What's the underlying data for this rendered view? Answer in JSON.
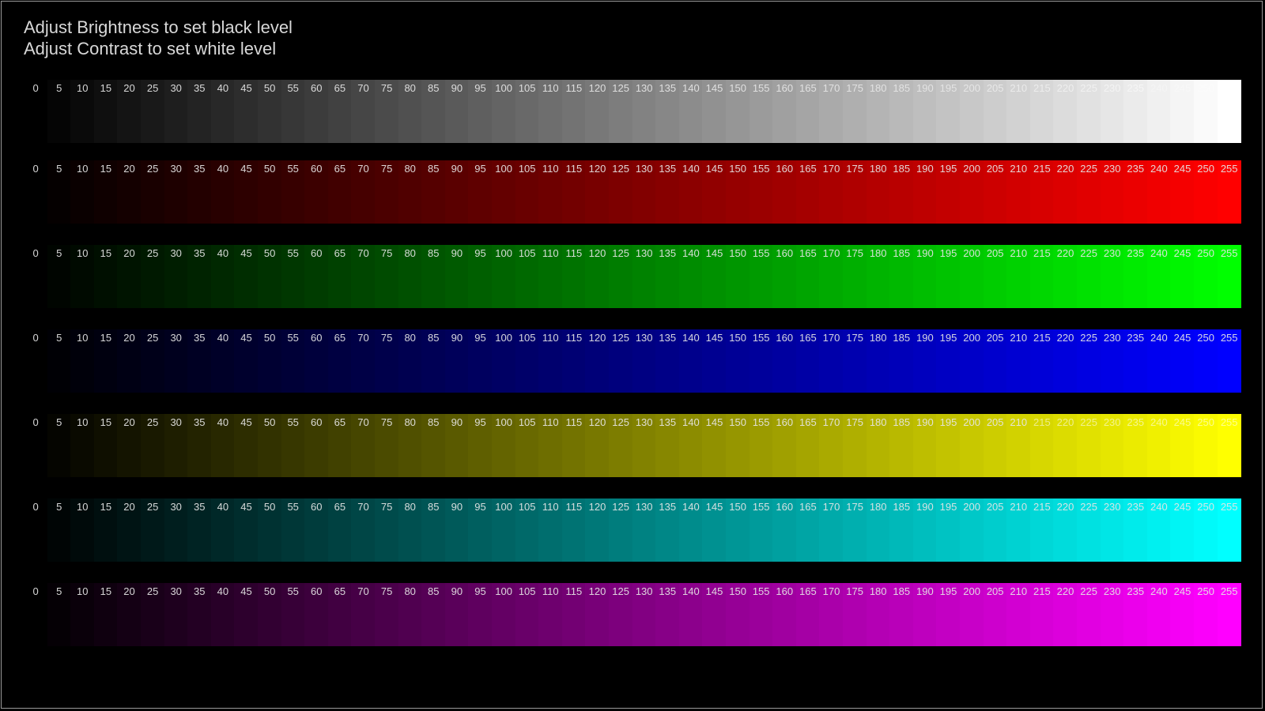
{
  "instructions": {
    "line1": "Adjust Brightness to set black level",
    "line2": "Adjust Contrast to set white level"
  },
  "levels": [
    0,
    5,
    10,
    15,
    20,
    25,
    30,
    35,
    40,
    45,
    50,
    55,
    60,
    65,
    70,
    75,
    80,
    85,
    90,
    95,
    100,
    105,
    110,
    115,
    120,
    125,
    130,
    135,
    140,
    145,
    150,
    155,
    160,
    165,
    170,
    175,
    180,
    185,
    190,
    195,
    200,
    205,
    210,
    215,
    220,
    225,
    230,
    235,
    240,
    245,
    250,
    255
  ],
  "ramps": [
    {
      "name": "gray",
      "color": "#ffffff",
      "labels": [
        "0",
        "5",
        "10",
        "15",
        "20",
        "25",
        "30",
        "35",
        "40",
        "45",
        "50",
        "55",
        "60",
        "65",
        "70",
        "75",
        "80",
        "85",
        "90",
        "95",
        "100",
        "105",
        "110",
        "115",
        "120",
        "125",
        "130",
        "135",
        "140",
        "145",
        "150",
        "155",
        "160",
        "165",
        "170",
        "175",
        "180",
        "185",
        "190",
        "195",
        "200",
        "205",
        "210",
        "215",
        "220",
        "225",
        "230",
        "235",
        "240",
        "245",
        "250",
        "255"
      ]
    },
    {
      "name": "red",
      "color": "#ff0000",
      "labels": [
        "0",
        "5",
        "10",
        "15",
        "20",
        "25",
        "30",
        "35",
        "40",
        "45",
        "50",
        "55",
        "60",
        "65",
        "70",
        "75",
        "80",
        "85",
        "90",
        "95",
        "100",
        "105",
        "110",
        "115",
        "120",
        "125",
        "130",
        "135",
        "140",
        "145",
        "150",
        "155",
        "160",
        "165",
        "170",
        "175",
        "180",
        "185",
        "190",
        "195",
        "200",
        "205",
        "210",
        "215",
        "220",
        "225",
        "230",
        "235",
        "240",
        "245",
        "250",
        "255"
      ]
    },
    {
      "name": "green",
      "color": "#00ff00",
      "labels": [
        "0",
        "5",
        "10",
        "15",
        "20",
        "25",
        "30",
        "35",
        "40",
        "45",
        "50",
        "55",
        "60",
        "65",
        "70",
        "75",
        "80",
        "85",
        "90",
        "95",
        "100",
        "105",
        "110",
        "115",
        "120",
        "125",
        "130",
        "135",
        "140",
        "145",
        "150",
        "155",
        "160",
        "165",
        "170",
        "175",
        "180",
        "185",
        "190",
        "195",
        "200",
        "205",
        "210",
        "215",
        "220",
        "225",
        "230",
        "235",
        "240",
        "245",
        "250",
        "255"
      ]
    },
    {
      "name": "blue",
      "color": "#0000ff",
      "labels": [
        "0",
        "5",
        "10",
        "15",
        "20",
        "25",
        "30",
        "35",
        "40",
        "45",
        "50",
        "55",
        "60",
        "65",
        "70",
        "75",
        "80",
        "85",
        "90",
        "95",
        "100",
        "105",
        "110",
        "115",
        "120",
        "125",
        "130",
        "135",
        "140",
        "145",
        "150",
        "155",
        "160",
        "165",
        "170",
        "175",
        "180",
        "185",
        "190",
        "195",
        "200",
        "205",
        "210",
        "215",
        "220",
        "225",
        "230",
        "235",
        "240",
        "245",
        "250",
        "255"
      ]
    },
    {
      "name": "yellow",
      "color": "#ffff00",
      "labels": [
        "0",
        "5",
        "10",
        "15",
        "20",
        "25",
        "30",
        "35",
        "40",
        "45",
        "50",
        "55",
        "60",
        "65",
        "70",
        "75",
        "80",
        "85",
        "90",
        "95",
        "100",
        "105",
        "110",
        "115",
        "120",
        "125",
        "130",
        "135",
        "140",
        "145",
        "150",
        "155",
        "160",
        "165",
        "170",
        "175",
        "180",
        "185",
        "190",
        "195",
        "200",
        "205",
        "210",
        "215",
        "220",
        "225",
        "230",
        "235",
        "240",
        "245",
        "250",
        "255"
      ]
    },
    {
      "name": "cyan",
      "color": "#00ffff",
      "labels": [
        "0",
        "5",
        "10",
        "15",
        "20",
        "25",
        "30",
        "35",
        "40",
        "45",
        "50",
        "55",
        "60",
        "65",
        "70",
        "75",
        "80",
        "85",
        "90",
        "95",
        "100",
        "105",
        "110",
        "115",
        "120",
        "125",
        "130",
        "135",
        "140",
        "145",
        "150",
        "155",
        "160",
        "165",
        "170",
        "175",
        "180",
        "185",
        "190",
        "195",
        "200",
        "205",
        "210",
        "215",
        "220",
        "225",
        "230",
        "235",
        "240",
        "245",
        "250",
        "255"
      ]
    },
    {
      "name": "magenta",
      "color": "#ff00ff",
      "labels": [
        "0",
        "5",
        "10",
        "15",
        "20",
        "25",
        "30",
        "35",
        "40",
        "45",
        "50",
        "55",
        "60",
        "65",
        "70",
        "75",
        "80",
        "85",
        "90",
        "95",
        "100",
        "105",
        "110",
        "115",
        "120",
        "125",
        "130",
        "135",
        "140",
        "145",
        "150",
        "155",
        "160",
        "165",
        "170",
        "175",
        "180",
        "185",
        "190",
        "195",
        "200",
        "205",
        "210",
        "215",
        "220",
        "225",
        "230",
        "235",
        "240",
        "245",
        "250",
        "255"
      ]
    }
  ]
}
